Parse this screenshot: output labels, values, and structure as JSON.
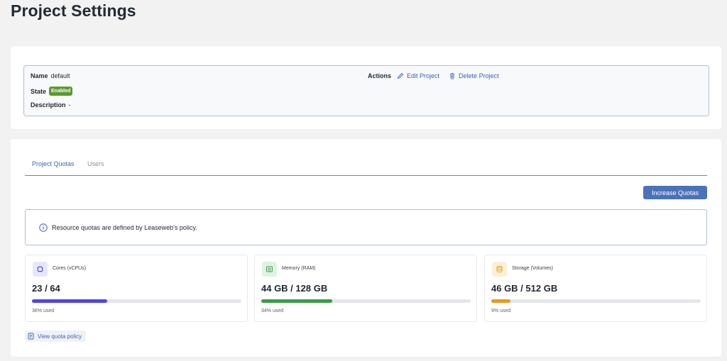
{
  "page": {
    "title": "Project Settings"
  },
  "project": {
    "name_label": "Name",
    "name_value": "default",
    "state_label": "State",
    "state_value": "Enabled",
    "description_label": "Description",
    "description_value": "-",
    "actions_label": "Actions",
    "edit_label": "Edit Project",
    "delete_label": "Delete Project"
  },
  "tabs": [
    {
      "label": "Project Quotas",
      "active": true
    },
    {
      "label": "Users",
      "active": false
    }
  ],
  "increase_button": "Increase Quotas",
  "notice": "Resource quotas are defined by Leaseweb's policy.",
  "quotas": [
    {
      "label": "Cores (vCPUs)",
      "value": "23 / 64",
      "used_text": "36% used",
      "used_fraction": 0.36,
      "color": "#4f46e5",
      "icon": "cpu-icon"
    },
    {
      "label": "Memory (RAM)",
      "value": "44 GB / 128 GB",
      "used_text": "34% used",
      "used_fraction": 0.34,
      "color": "#3a9b48",
      "icon": "memory-icon"
    },
    {
      "label": "Storage (Volumes)",
      "value": "46 GB / 512 GB",
      "used_text": "9% used",
      "used_fraction": 0.09,
      "color": "#e59a1a",
      "icon": "database-icon"
    }
  ],
  "policy_link": "View quota policy",
  "colors": {
    "accent": "#3b63b5",
    "enabled_badge": "#5c9a2e",
    "button": "#4a72b8"
  }
}
